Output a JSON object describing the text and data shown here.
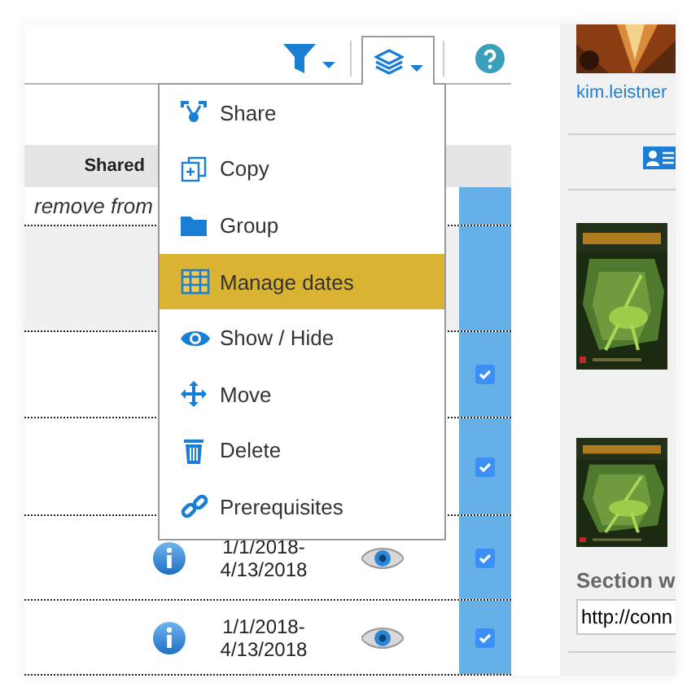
{
  "toolbar": {
    "layers_open": true
  },
  "menu": {
    "items": [
      {
        "label": "Share",
        "selected": false
      },
      {
        "label": "Copy",
        "selected": false
      },
      {
        "label": "Group",
        "selected": false
      },
      {
        "label": "Manage dates",
        "selected": true
      },
      {
        "label": "Show / Hide",
        "selected": false
      },
      {
        "label": "Move",
        "selected": false
      },
      {
        "label": "Delete",
        "selected": false
      },
      {
        "label": "Prerequisites",
        "selected": false
      }
    ]
  },
  "table": {
    "columns": [
      "Shared"
    ],
    "rows": [
      {
        "note": "remove from",
        "highlighted": false
      },
      {
        "highlighted": true
      },
      {
        "highlighted": false,
        "checked": true
      },
      {
        "highlighted": false,
        "checked": true
      },
      {
        "highlighted": false,
        "checked": true,
        "dates": [
          "1/1/2018-",
          "4/13/2018"
        ]
      },
      {
        "highlighted": false,
        "checked": true,
        "dates": [
          "1/1/2018-",
          "4/13/2018"
        ]
      }
    ]
  },
  "sidebar": {
    "user": "kim.leistner",
    "section_label": "Section w",
    "url_field": {
      "value": "http://conn"
    }
  }
}
